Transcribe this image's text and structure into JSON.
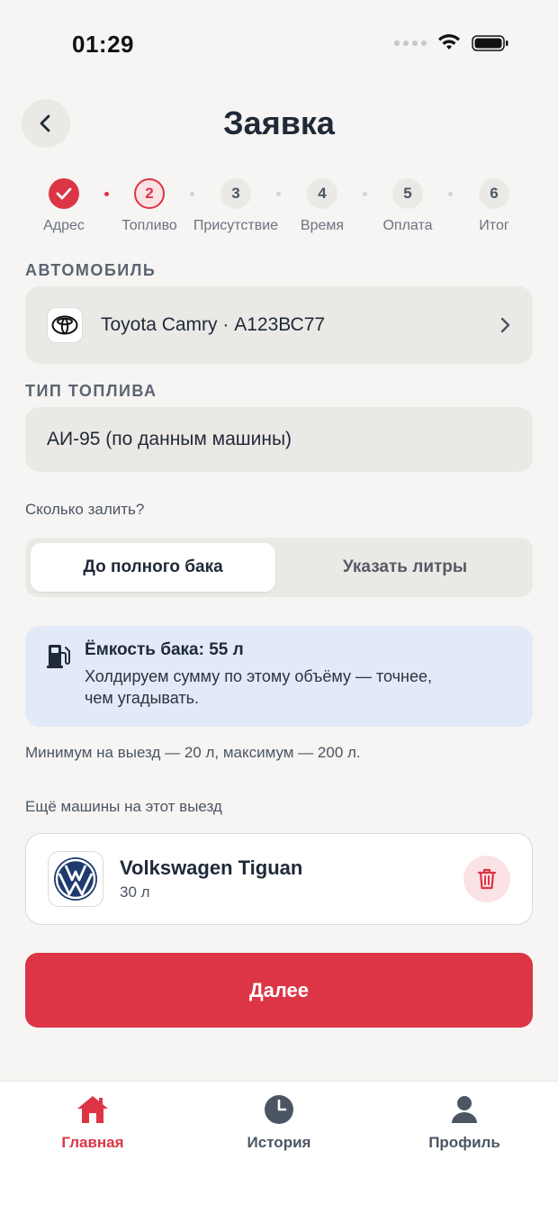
{
  "status_bar": {
    "time": "01:29"
  },
  "header": {
    "title": "Заявка",
    "back_icon": "chevron-left-icon"
  },
  "stepper": {
    "steps": [
      {
        "number": "1",
        "label": "Адрес",
        "state": "done"
      },
      {
        "number": "2",
        "label": "Топливо",
        "state": "current"
      },
      {
        "number": "3",
        "label": "Присутствие",
        "state": "upcoming"
      },
      {
        "number": "4",
        "label": "Время",
        "state": "upcoming"
      },
      {
        "number": "5",
        "label": "Оплата",
        "state": "upcoming"
      },
      {
        "number": "6",
        "label": "Итог",
        "state": "upcoming"
      }
    ]
  },
  "vehicle": {
    "section_label": "АВТОМОБИЛЬ",
    "car": "Toyota Camry · А123ВС77",
    "brand_icon": "toyota-logo-icon"
  },
  "fuel": {
    "section_label": "ТИП ТОПЛИВА",
    "value": "АИ-95 (по данным машины)"
  },
  "amount": {
    "question": "Сколько залить?",
    "options": [
      "До полного бака",
      "Указать литры"
    ],
    "selected": "До полного бака"
  },
  "tank_info": {
    "title": "Ёмкость бака: 55 л",
    "body_line1": "Холдируем сумму по этому объёму — точнее,",
    "body_line2": "чем угадывать.",
    "icon": "fuel-pump-icon"
  },
  "limits_note": "Минимум на выезд — 20 л, максимум — 200 л.",
  "extra_cars": {
    "label": "Ещё машины на этот выезд",
    "items": [
      {
        "name": "Volkswagen Tiguan",
        "liters": "30 л",
        "brand_icon": "volkswagen-logo-icon"
      }
    ]
  },
  "primary_button": {
    "label": "Далее"
  },
  "tabbar": {
    "items": [
      {
        "label": "Главная",
        "icon": "home-icon",
        "active": true
      },
      {
        "label": "История",
        "icon": "clock-icon",
        "active": false
      },
      {
        "label": "Профиль",
        "icon": "user-icon",
        "active": false
      }
    ]
  },
  "colors": {
    "accent": "#dc3545",
    "background": "#f6f5f3",
    "info_background": "#e2eaf8",
    "text_primary": "#1f2937"
  }
}
